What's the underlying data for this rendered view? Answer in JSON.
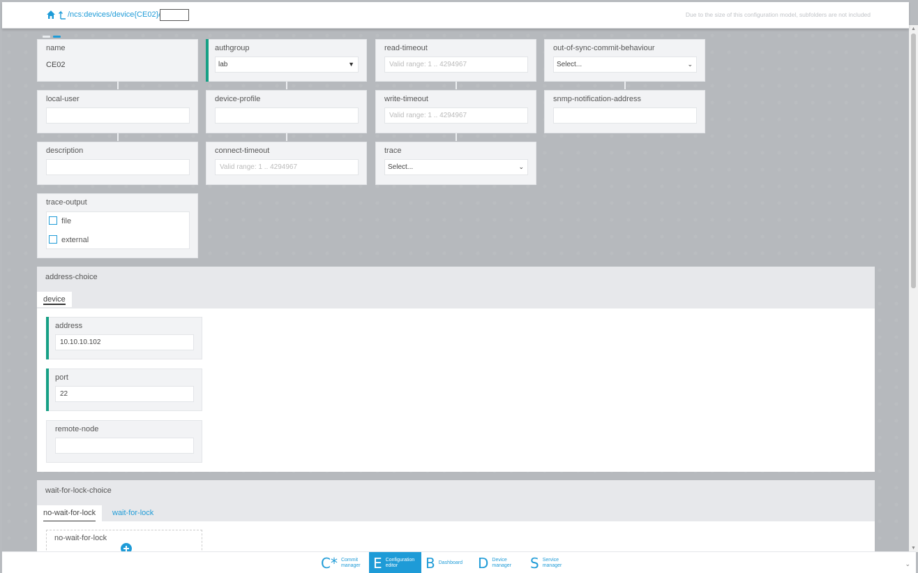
{
  "topbar": {
    "breadcrumb": "/ncs:devices/device{CE02}/",
    "path_input_value": "",
    "note": "Due to the size of this configuration model, subfolders are not included"
  },
  "colors": {
    "accent": "#1e9bd7",
    "required": "#16a085",
    "card_bg": "#f2f3f5",
    "canvas_bg": "#b6b9bd"
  },
  "fields": {
    "name": {
      "label": "name",
      "value": "CE02"
    },
    "authgroup": {
      "label": "authgroup",
      "value": "lab"
    },
    "read_timeout": {
      "label": "read-timeout",
      "placeholder": "Valid range: 1 .. 4294967"
    },
    "oos_commit": {
      "label": "out-of-sync-commit-behaviour",
      "value": "Select..."
    },
    "local_user": {
      "label": "local-user",
      "value": ""
    },
    "device_profile": {
      "label": "device-profile",
      "value": ""
    },
    "write_timeout": {
      "label": "write-timeout",
      "placeholder": "Valid range: 1 .. 4294967"
    },
    "snmp_addr": {
      "label": "snmp-notification-address",
      "value": ""
    },
    "description": {
      "label": "description",
      "value": ""
    },
    "connect_timeout": {
      "label": "connect-timeout",
      "placeholder": "Valid range: 1 .. 4294967"
    },
    "trace": {
      "label": "trace",
      "value": "Select..."
    },
    "trace_output": {
      "label": "trace-output",
      "options": [
        "file",
        "external"
      ]
    }
  },
  "address_choice": {
    "title": "address-choice",
    "tabs": [
      "device"
    ],
    "address": {
      "label": "address",
      "value": "10.10.10.102"
    },
    "port": {
      "label": "port",
      "value": "22"
    },
    "remote_node": {
      "label": "remote-node",
      "value": ""
    }
  },
  "wait_for_lock_choice": {
    "title": "wait-for-lock-choice",
    "tabs": [
      "no-wait-for-lock",
      "wait-for-lock"
    ],
    "no_wait_label": "no-wait-for-lock"
  },
  "apps": [
    {
      "letter": "C*",
      "label": "Commit manager"
    },
    {
      "letter": "E",
      "label": "Configuration editor"
    },
    {
      "letter": "B",
      "label": "Dashboard"
    },
    {
      "letter": "D",
      "label": "Device manager"
    },
    {
      "letter": "S",
      "label": "Service manager"
    }
  ]
}
